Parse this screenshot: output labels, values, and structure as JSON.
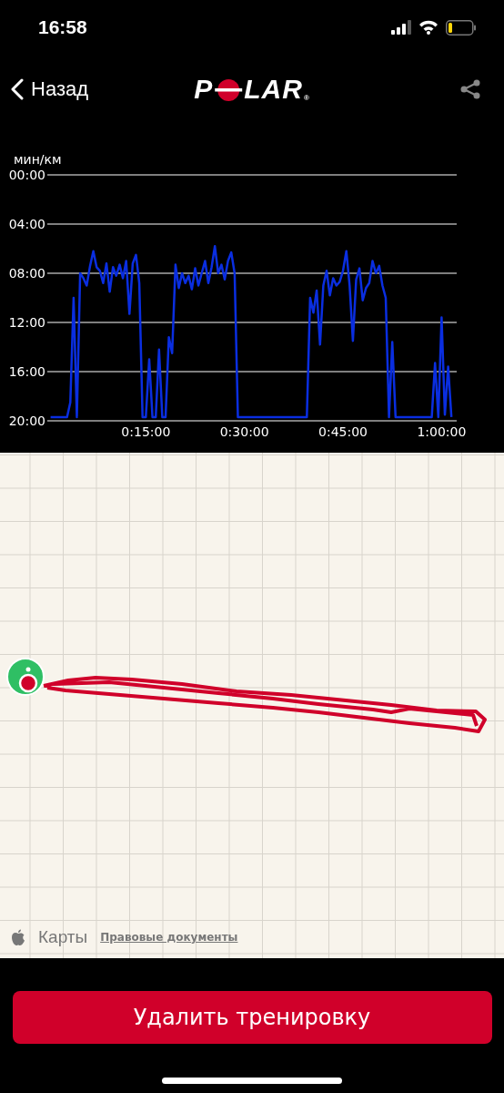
{
  "status_bar": {
    "time": "16:58"
  },
  "nav": {
    "back_label": "Назад",
    "logo": {
      "before": "P",
      "after": "LAR",
      "mark": "®"
    }
  },
  "pace_chart": {
    "chart_data": {
      "type": "line",
      "ylabel": "мин/км",
      "grid": true,
      "xlim": [
        0,
        62.3
      ],
      "ylim": [
        20,
        0
      ],
      "yticks": [
        {
          "value": 0,
          "label": "00:00"
        },
        {
          "value": 4,
          "label": "04:00"
        },
        {
          "value": 8,
          "label": "08:00"
        },
        {
          "value": 12,
          "label": "12:00"
        },
        {
          "value": 16,
          "label": "16:00"
        },
        {
          "value": 20,
          "label": "20:00"
        }
      ],
      "xticks": [
        {
          "value": 15,
          "label": "0:15:00"
        },
        {
          "value": 30,
          "label": "0:30:00"
        },
        {
          "value": 45,
          "label": "0:45:00"
        },
        {
          "value": 60,
          "label": "1:00:00"
        }
      ],
      "x": [
        0.5,
        1,
        1.5,
        2,
        2.5,
        3,
        3.5,
        4,
        4.5,
        5,
        5.5,
        6,
        6.5,
        7,
        7.5,
        8,
        8.5,
        9,
        9.5,
        10,
        10.5,
        11,
        11.5,
        12,
        12.5,
        13,
        13.5,
        14,
        14.5,
        15,
        15.5,
        16,
        16.5,
        17,
        17.5,
        18,
        18.5,
        19,
        19.5,
        20,
        20.5,
        21,
        21.5,
        22,
        22.5,
        23,
        23.5,
        24,
        24.5,
        25,
        25.5,
        26,
        26.5,
        27,
        27.5,
        28,
        28.5,
        29,
        29.5,
        30,
        30.5,
        31,
        31.5,
        32,
        32.5,
        33,
        33.5,
        34,
        34.5,
        35,
        35.5,
        36,
        36.5,
        37,
        37.5,
        38,
        38.5,
        39,
        39.5,
        40,
        40.5,
        41,
        41.5,
        42,
        42.5,
        43,
        43.5,
        44,
        44.5,
        45,
        45.5,
        46,
        46.5,
        47,
        47.5,
        48,
        48.5,
        49,
        49.5,
        50,
        50.5,
        51,
        51.5,
        52,
        52.5,
        53,
        53.5,
        54,
        54.5,
        55,
        55.5,
        56,
        56.5,
        57,
        57.5,
        58,
        58.5,
        59,
        59.5,
        60,
        60.5,
        61,
        61.5
      ],
      "series": [
        {
          "color": "#0a2ee0",
          "values": [
            19.7,
            19.7,
            19.7,
            19.7,
            19.7,
            19.7,
            18.5,
            10,
            19.7,
            8.0,
            8.4,
            9.0,
            7.4,
            6.2,
            7.5,
            7.8,
            8.8,
            7.2,
            9.5,
            7.5,
            8.2,
            7.3,
            8.4,
            7.0,
            11.3,
            7.2,
            6.5,
            8.8,
            19.7,
            19.7,
            15.0,
            19.7,
            19.7,
            14.2,
            19.7,
            19.7,
            13.2,
            14.5,
            7.3,
            9.2,
            8.0,
            8.8,
            8.2,
            9.3,
            7.6,
            9.0,
            8.0,
            7.0,
            8.8,
            7.5,
            5.8,
            8.0,
            7.3,
            8.5,
            7.0,
            6.3,
            8.0,
            19.7,
            19.7,
            19.7,
            19.7,
            19.7,
            19.7,
            19.7,
            19.7,
            19.7,
            19.7,
            19.7,
            19.7,
            19.7,
            19.7,
            19.7,
            19.7,
            19.7,
            19.7,
            19.7,
            19.7,
            19.7,
            19.7,
            10.0,
            11.2,
            9.4,
            13.8,
            9.0,
            7.8,
            9.8,
            8.4,
            9.0,
            8.7,
            7.8,
            6.2,
            9.0,
            13.5,
            8.5,
            7.6,
            10.2,
            9.2,
            8.8,
            7.0,
            8.0,
            7.4,
            9.0,
            10.0,
            19.7,
            13.6,
            19.7,
            19.7,
            19.7,
            19.7,
            19.7,
            19.7,
            19.7,
            19.7,
            19.7,
            19.7,
            19.7,
            19.7,
            15.3,
            19.7,
            11.6,
            19.5,
            15.6,
            19.7
          ]
        }
      ]
    }
  },
  "map": {
    "brand": "Карты",
    "legal_link": "Правовые документы"
  },
  "delete_button": "Удалить тренировку"
}
